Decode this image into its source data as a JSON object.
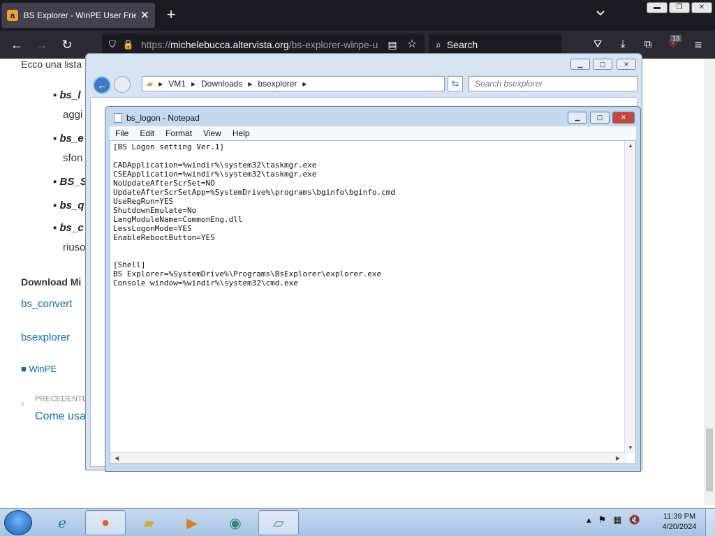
{
  "browser": {
    "tab_title": "BS Explorer - WinPE User Friendly",
    "tab_favicon": "a",
    "new_tab": "+",
    "url_prefix": "https://",
    "url_host": "michelebucca.altervista.org",
    "url_path": "/bs-explorer-winpe-u",
    "search_placeholder": "Search",
    "extension_badge": "13"
  },
  "page": {
    "intro": "Ecco una lista",
    "bullets": [
      {
        "title": "bs_l",
        "rest": ""
      },
      {
        "title": "bs_e",
        "rest": ""
      },
      {
        "title": "BS_S",
        "rest": ""
      },
      {
        "title": "bs_q",
        "rest": ""
      },
      {
        "title": "bs_c",
        "rest": ""
      }
    ],
    "bullet_line2_a": "aggi",
    "bullet_line2_b": "sfon",
    "bullet_line2_c": "riuso",
    "download_heading": "Download Mi",
    "link_convert": "bs_convert",
    "link_bsexplorer": "bsexplorer",
    "category": "WinPE",
    "prev_label": "PRECEDENTE",
    "prev_title": "Come usa"
  },
  "explorer": {
    "breadcrumb": [
      "VM1",
      "Downloads",
      "bsexplorer"
    ],
    "search_placeholder": "Search bsexplorer"
  },
  "notepad": {
    "title": "bs_logon - Notepad",
    "menu": [
      "File",
      "Edit",
      "Format",
      "View",
      "Help"
    ],
    "content": "[BS Logon setting Ver.1]\n\nCADApplication=%windir%\\system32\\taskmgr.exe\nCSEApplication=%windir%\\system32\\taskmgr.exe\nNoUpdateAfterScrSet=NO\nUpdateAfterScrSetApp=%SystemDrive%\\programs\\bginfo\\bginfo.cmd\nUseRegRun=YES\nShutdownEmulate=No\nLangModuleName=CommonEng.dll\nLessLogonMode=YES\nEnableRebootButton=YES\n\n\n[Shell]\nBS Explorer=%SystemDrive%\\Programs\\BsExplorer\\explorer.exe\nConsole window=%windir%\\system32\\cmd.exe"
  },
  "taskbar": {
    "time": "11:39 PM",
    "date": "4/20/2024"
  }
}
